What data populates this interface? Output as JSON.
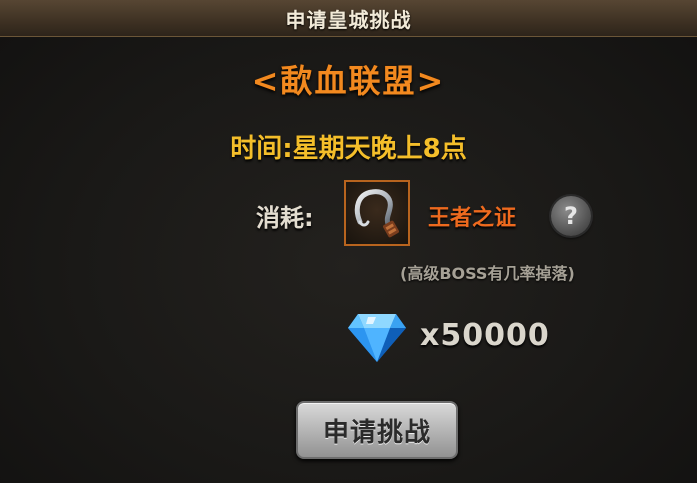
{
  "dialog": {
    "title": "申请皇城挑战",
    "guild_name": "<歃血联盟>",
    "time_text": "时间:星期天晚上8点",
    "cost": {
      "label": "消耗:",
      "item_name": "王者之证",
      "item_icon": "hook-icon",
      "help_symbol": "?",
      "drop_note": "(高级BOSS有几率掉落)"
    },
    "diamond": {
      "icon": "blue-diamond-icon",
      "amount": "x50000"
    },
    "apply_button_label": "申请挑战"
  },
  "colors": {
    "guild_name": "#f2891f",
    "time_text": "#f4be2a",
    "item_name": "#ee6a1e",
    "item_border": "#b8641e"
  }
}
